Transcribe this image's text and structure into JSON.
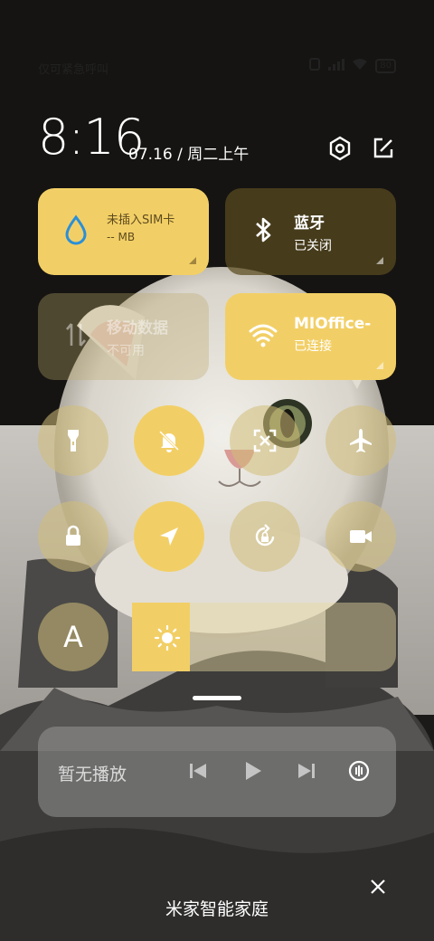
{
  "status_bar": {
    "carrier": "仅可紧急呼叫",
    "battery": "80"
  },
  "header": {
    "time": "8:16",
    "date": "07.16 / 周二上午",
    "icons": [
      "settings-hex-icon",
      "edit-icon"
    ]
  },
  "tiles": [
    {
      "id": "data-usage",
      "icon": "water-drop-icon",
      "title": "未插入SIM卡",
      "subtitle": "-- MB",
      "state": "on"
    },
    {
      "id": "bluetooth",
      "icon": "bluetooth-icon",
      "title": "蓝牙",
      "subtitle": "已关闭",
      "state": "off"
    },
    {
      "id": "mobile-data",
      "icon": "mobile-data-icon",
      "title": "移动数据",
      "subtitle": "不可用",
      "state": "disabled"
    },
    {
      "id": "wifi",
      "icon": "wifi-icon",
      "title": "MIOffice-",
      "subtitle": "已连接",
      "state": "on"
    }
  ],
  "toggles": [
    {
      "id": "flashlight",
      "icon": "flashlight-icon",
      "state": "off"
    },
    {
      "id": "mute",
      "icon": "bell-off-icon",
      "state": "on"
    },
    {
      "id": "screenshot",
      "icon": "screenshot-icon",
      "state": "off"
    },
    {
      "id": "airplane",
      "icon": "airplane-icon",
      "state": "off"
    },
    {
      "id": "lock",
      "icon": "lock-icon",
      "state": "off"
    },
    {
      "id": "location",
      "icon": "location-arrow-icon",
      "state": "on"
    },
    {
      "id": "rotation-lock",
      "icon": "rotation-lock-icon",
      "state": "off"
    },
    {
      "id": "screen-record",
      "icon": "video-camera-icon",
      "state": "off"
    }
  ],
  "auto_brightness": {
    "label": "A",
    "state": "off"
  },
  "brightness": {
    "level": 0.22
  },
  "media": {
    "label": "暂无播放"
  },
  "footer": {
    "label": "米家智能家庭"
  },
  "colors": {
    "accent": "#f2cf66",
    "tile_off": "#5a4b1e"
  }
}
